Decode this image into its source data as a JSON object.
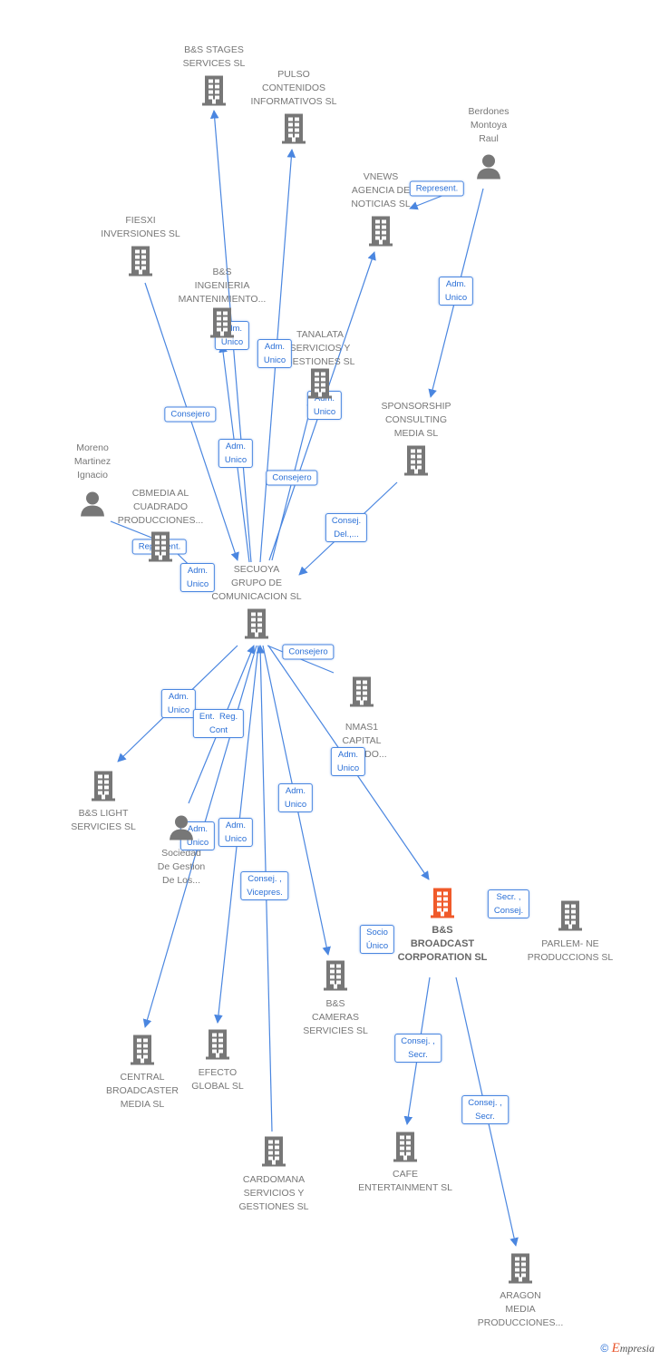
{
  "colors": {
    "edge": "#4a86e0",
    "building": "#777777",
    "focus_building": "#f05a2a",
    "person": "#777777"
  },
  "nodes": [
    {
      "id": "bs_stages",
      "type": "company",
      "label": "B&S STAGES\nSERVICES SL"
    },
    {
      "id": "pulso",
      "type": "company",
      "label": "PULSO\nCONTENIDOS\nINFORMATIVOS SL"
    },
    {
      "id": "berdones",
      "type": "person",
      "label": "Berdones\nMontoya\nRaul"
    },
    {
      "id": "vnews",
      "type": "company",
      "label": "VNEWS\nAGENCIA DE\nNOTICIAS SL"
    },
    {
      "id": "fiesxi",
      "type": "company",
      "label": "FIESXI\nINVERSIONES SL"
    },
    {
      "id": "bs_ingenieria",
      "type": "company",
      "label": "B&S\nINGENIERIA\nMANTENIMIENTO..."
    },
    {
      "id": "tanalata",
      "type": "company",
      "label": "TANALATA\nSERVICIOS Y\nGESTIONES SL"
    },
    {
      "id": "sponsorship",
      "type": "company",
      "label": "SPONSORSHIP\nCONSULTING\nMEDIA SL"
    },
    {
      "id": "moreno",
      "type": "person",
      "label": "Moreno\nMartinez\nIgnacio"
    },
    {
      "id": "cbmedia",
      "type": "company",
      "label": "CBMEDIA AL\nCUADRADO\nPRODUCCIONES..."
    },
    {
      "id": "secuoya",
      "type": "company",
      "label": "SECUOYA\nGRUPO DE\nCOMUNICACION SL"
    },
    {
      "id": "nmas1",
      "type": "company",
      "label": "NMAS1\nCAPITAL\nPRIVADO..."
    },
    {
      "id": "bs_light",
      "type": "company",
      "label": "B&S LIGHT\nSERVICIES SL"
    },
    {
      "id": "sociedad",
      "type": "person",
      "label": "Sociedad\nDe Gestion\nDe Los..."
    },
    {
      "id": "bs_broadcast",
      "type": "focus",
      "label": "B&S\nBROADCAST\nCORPORATION SL"
    },
    {
      "id": "parlem",
      "type": "company",
      "label": "PARLEM- NE\nPRODUCCIONS SL"
    },
    {
      "id": "bs_cameras",
      "type": "company",
      "label": "B&S\nCAMERAS\nSERVICIES SL"
    },
    {
      "id": "central",
      "type": "company",
      "label": "CENTRAL\nBROADCASTER\nMEDIA SL"
    },
    {
      "id": "efecto",
      "type": "company",
      "label": "EFECTO\nGLOBAL SL"
    },
    {
      "id": "cafe",
      "type": "company",
      "label": "CAFE\nENTERTAINMENT SL"
    },
    {
      "id": "cardomana",
      "type": "company",
      "label": "CARDOMANA\nSERVICIOS Y\nGESTIONES SL"
    },
    {
      "id": "aragon",
      "type": "company",
      "label": "ARAGON\nMEDIA\nPRODUCCIONES..."
    }
  ],
  "edges": [
    {
      "from": "secuoya",
      "to": "bs_stages",
      "label": "Adm.\nUnico"
    },
    {
      "from": "secuoya",
      "to": "pulso",
      "label": "Adm.\nUnico"
    },
    {
      "from": "secuoya",
      "to": "vnews",
      "label": "Adm.\nUnico"
    },
    {
      "from": "fiesxi",
      "to": "secuoya",
      "label": "Consejero"
    },
    {
      "from": "secuoya",
      "to": "bs_ingenieria",
      "label": "Adm.\nUnico"
    },
    {
      "from": "tanalata",
      "to": "secuoya",
      "label": "Consejero"
    },
    {
      "from": "berdones",
      "to": "sponsorship",
      "label": "Adm.\nUnico"
    },
    {
      "from": "berdones",
      "to": "vnews",
      "label": "Represent."
    },
    {
      "from": "sponsorship",
      "to": "secuoya",
      "label": "Consej.\nDel.,..."
    },
    {
      "from": "moreno",
      "to": "cbmedia",
      "label": "Represent."
    },
    {
      "from": "cbmedia",
      "to": "secuoya",
      "label": "Adm.\nUnico"
    },
    {
      "from": "secuoya",
      "to": "bs_light",
      "label": "Adm.\nUnico"
    },
    {
      "from": "secuoya",
      "to": "bs_broadcast",
      "label": "Adm.\nUnico"
    },
    {
      "from": "nmas1",
      "to": "secuoya",
      "label": "Consejero"
    },
    {
      "from": "sociedad",
      "to": "secuoya",
      "label": "Ent.  Reg.\nCont"
    },
    {
      "from": "secuoya",
      "to": "central",
      "label": "Adm.\nUnico"
    },
    {
      "from": "secuoya",
      "to": "efecto",
      "label": "Adm.\nUnico"
    },
    {
      "from": "cardomana",
      "to": "secuoya",
      "label": "Consej. ,\nVicepres."
    },
    {
      "from": "secuoya",
      "to": "bs_cameras",
      "label": "Adm.\nUnico"
    },
    {
      "from": "bs_broadcast",
      "to": "cafe",
      "label": "Consej. ,\nSecr."
    },
    {
      "from": "bs_broadcast",
      "to": "aragon",
      "label": "Consej. ,\nSecr."
    },
    {
      "from": "bs_broadcast",
      "to": "bs_broadcast",
      "label": "Socio\nÚnico"
    },
    {
      "from": "parlem",
      "to": "bs_broadcast",
      "label": "Secr. ,\nConsej."
    }
  ],
  "footer": {
    "copyright": "©",
    "brand_initial": "E",
    "brand_rest": "mpresia"
  }
}
